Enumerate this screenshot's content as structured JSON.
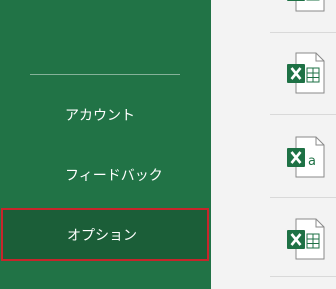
{
  "sidebar": {
    "items": [
      {
        "label": "アカウント"
      },
      {
        "label": "フィードバック"
      },
      {
        "label": "オプション"
      }
    ]
  },
  "files": [
    {
      "icon": "excel-workbook-icon"
    },
    {
      "icon": "excel-workbook-icon"
    },
    {
      "icon": "excel-template-icon",
      "badge": "a"
    },
    {
      "icon": "excel-workbook-icon"
    }
  ],
  "colors": {
    "sidebar_bg": "#217346",
    "selected_border": "#c7252b",
    "excel_green": "#1e7145"
  }
}
